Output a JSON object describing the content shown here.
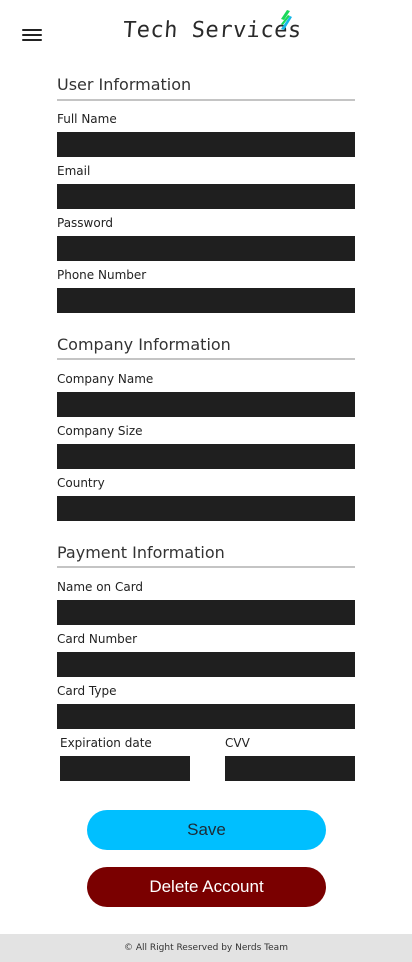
{
  "header": {
    "logo_text": "Tech Services",
    "menu_icon": "hamburger-menu-icon",
    "leaf_colors": [
      "#19d85a",
      "#16b7e8"
    ]
  },
  "user_info": {
    "title": "User Information",
    "full_name_label": "Full Name",
    "email_label": "Email",
    "password_label": "Password",
    "phone_label": "Phone Number"
  },
  "company_info": {
    "title": "Company Information",
    "company_name_label": "Company Name",
    "company_size_label": "Company Size",
    "country_label": "Country"
  },
  "payment_info": {
    "title": "Payment Information",
    "name_on_card_label": "Name on Card",
    "card_number_label": "Card Number",
    "card_type_label": "Card Type",
    "expiration_label": "Expiration date",
    "cvv_label": "CVV"
  },
  "actions": {
    "save_label": "Save",
    "delete_label": "Delete Account"
  },
  "footer": {
    "text": "© All Right Reserved by Nerds Team"
  },
  "colors": {
    "field_bg": "#1f1f1f",
    "save_bg": "#00bfff",
    "delete_bg": "#7a0000",
    "footer_bg": "#e3e3e3"
  }
}
